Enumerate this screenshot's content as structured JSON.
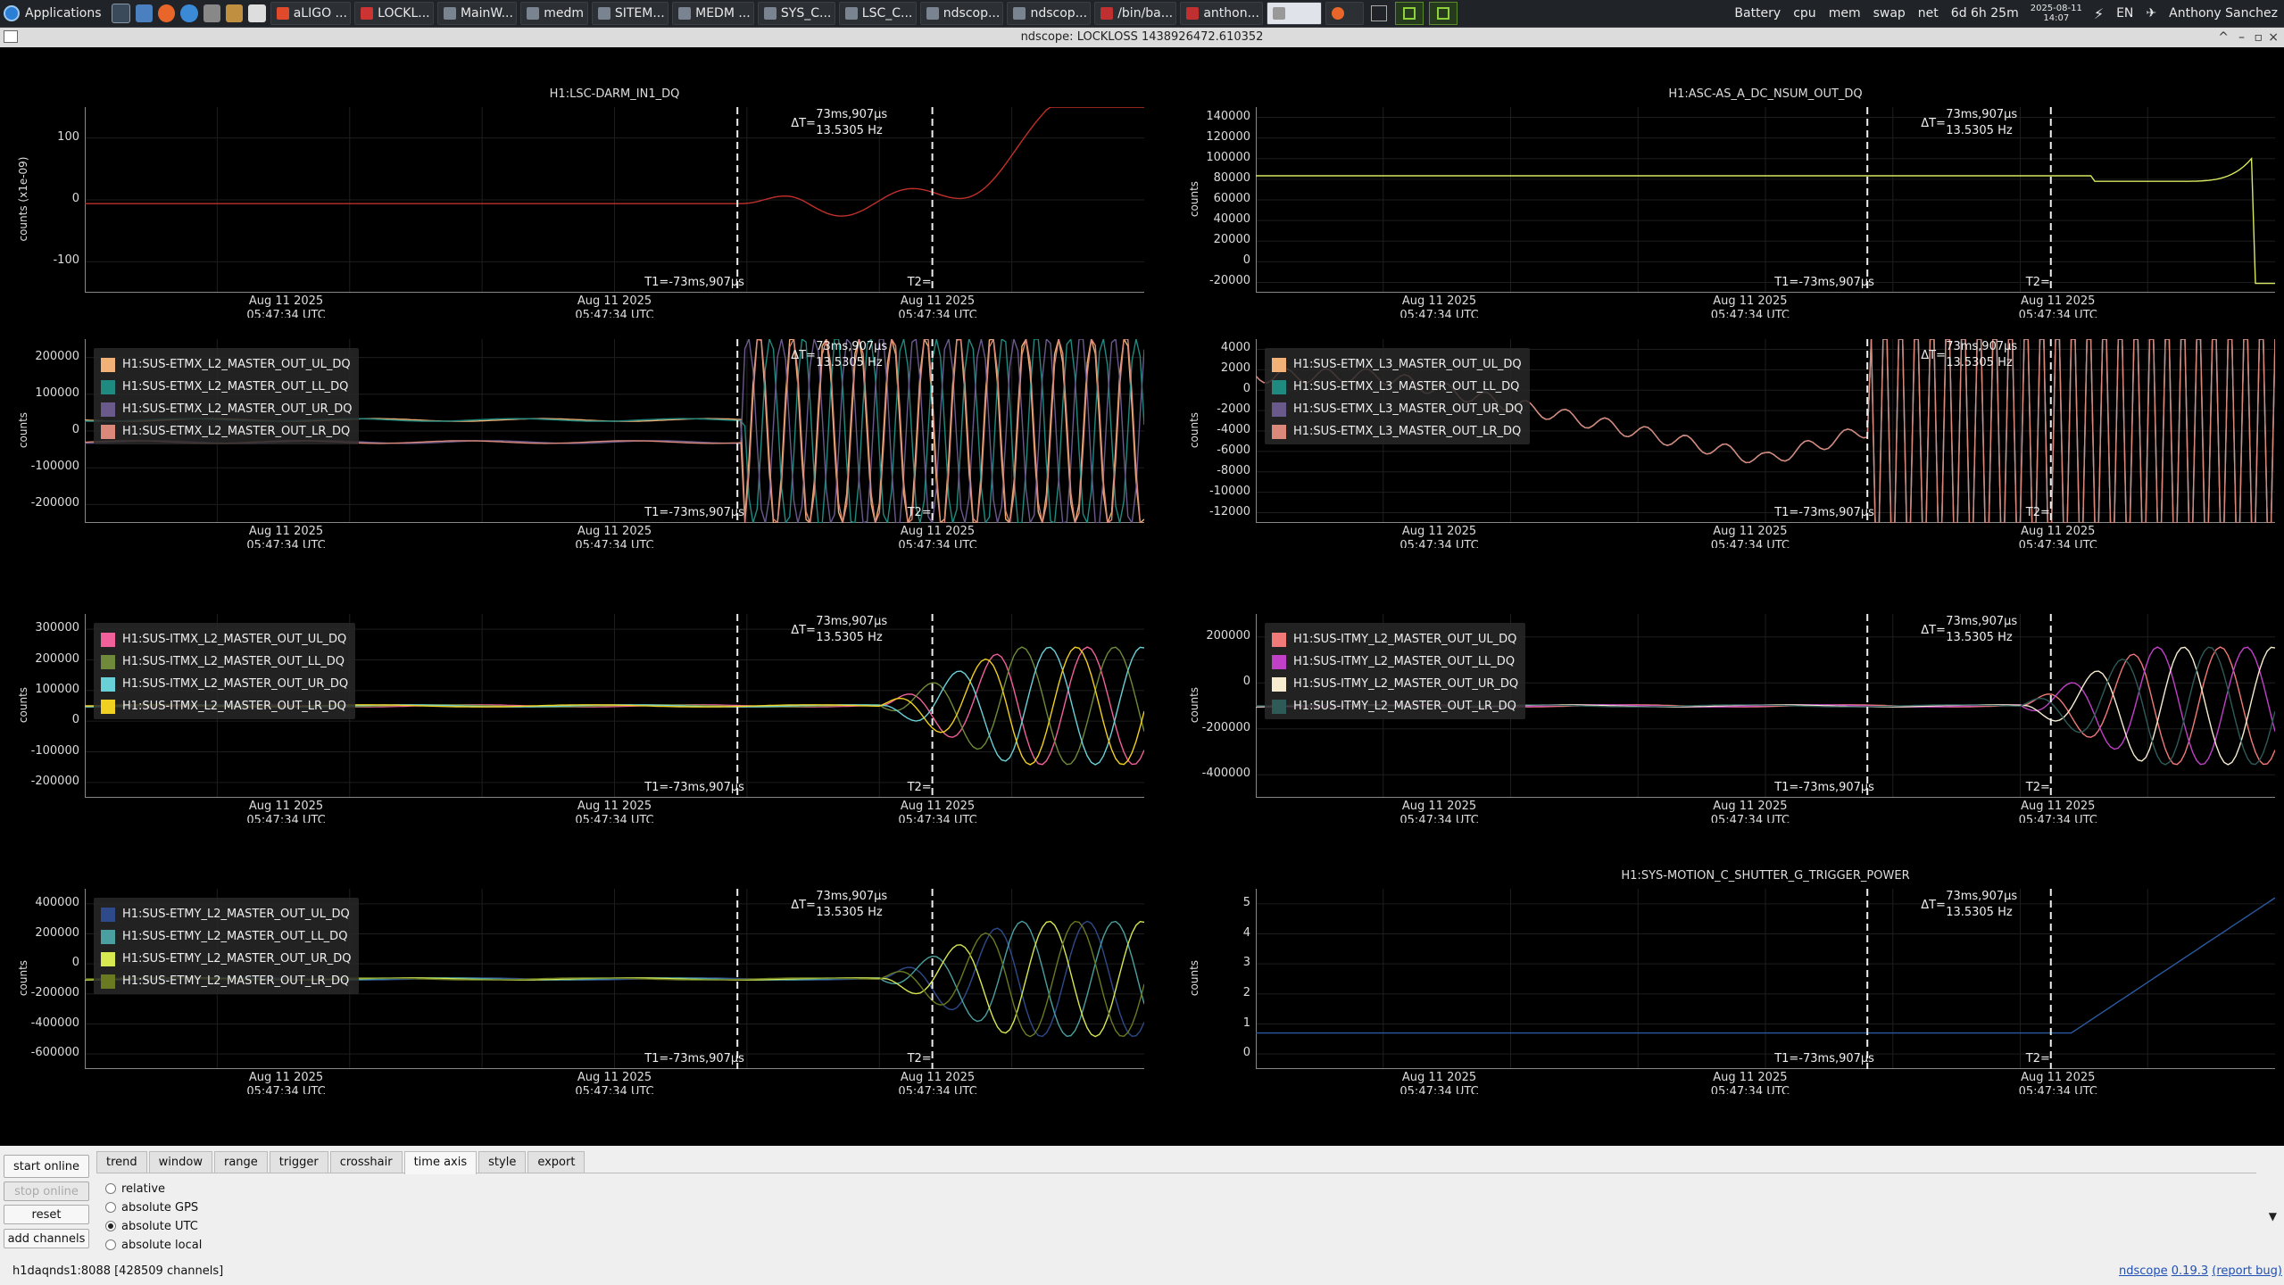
{
  "taskbar": {
    "applications_label": "Applications",
    "tasks": [
      "aLIGO ...",
      "LOCKL...",
      "MainW...",
      "medm",
      "SITEM...",
      "MEDM ...",
      "SYS_C...",
      "LSC_C...",
      "ndscop...",
      "ndscop...",
      "/bin/ba...",
      "anthon..."
    ],
    "tray": {
      "battery": "Battery",
      "cpu": "cpu",
      "mem": "mem",
      "swap": "swap",
      "net": "net",
      "uptime": "6d 6h 25m",
      "date": "2025-08-11",
      "time": "14:07",
      "lang": "EN",
      "user": "Anthony Sanchez"
    }
  },
  "window": {
    "title": "ndscope: LOCKLOSS 1438926472.610352",
    "controls": [
      "^",
      "–",
      "▫",
      "×"
    ]
  },
  "cursors": {
    "delta_t": "ΔT=",
    "delta_value": "73ms,907μs",
    "delta_freq": "13.5305 Hz",
    "t1_label": "T1=-73ms,907μs",
    "t2_label": "T2="
  },
  "x_ticks": [
    {
      "date": "Aug 11 2025",
      "time": "05:47:34 UTC"
    },
    {
      "date": "Aug 11 2025",
      "time": "05:47:34 UTC"
    },
    {
      "date": "Aug 11 2025",
      "time": "05:47:34 UTC"
    }
  ],
  "plots": [
    {
      "id": "darm",
      "title": "H1:LSC-DARM_IN1_DQ",
      "ylabel": "counts (x1e-09)",
      "yticks": [
        "100",
        "0",
        "-100"
      ],
      "legend": []
    },
    {
      "id": "asc",
      "title": "H1:ASC-AS_A_DC_NSUM_OUT_DQ",
      "ylabel": "counts",
      "yticks": [
        "140000",
        "120000",
        "100000",
        "80000",
        "60000",
        "40000",
        "20000",
        "0",
        "-20000"
      ],
      "legend": []
    },
    {
      "id": "etmx-l2",
      "title": "",
      "ylabel": "counts",
      "yticks": [
        "200000",
        "100000",
        "0",
        "-100000",
        "-200000"
      ],
      "legend": [
        {
          "name": "H1:SUS-ETMX_L2_MASTER_OUT_UL_DQ",
          "color": "#f2b176"
        },
        {
          "name": "H1:SUS-ETMX_L2_MASTER_OUT_LL_DQ",
          "color": "#1f8a80"
        },
        {
          "name": "H1:SUS-ETMX_L2_MASTER_OUT_UR_DQ",
          "color": "#6a5a8c"
        },
        {
          "name": "H1:SUS-ETMX_L2_MASTER_OUT_LR_DQ",
          "color": "#d9887a"
        }
      ]
    },
    {
      "id": "etmx-l3",
      "title": "",
      "ylabel": "counts",
      "yticks": [
        "4000",
        "2000",
        "0",
        "-2000",
        "-4000",
        "-6000",
        "-8000",
        "-10000",
        "-12000"
      ],
      "legend": [
        {
          "name": "H1:SUS-ETMX_L3_MASTER_OUT_UL_DQ",
          "color": "#f2b176"
        },
        {
          "name": "H1:SUS-ETMX_L3_MASTER_OUT_LL_DQ",
          "color": "#1f8a80"
        },
        {
          "name": "H1:SUS-ETMX_L3_MASTER_OUT_UR_DQ",
          "color": "#6a5a8c"
        },
        {
          "name": "H1:SUS-ETMX_L3_MASTER_OUT_LR_DQ",
          "color": "#d9887a"
        }
      ]
    },
    {
      "id": "itmx-l2",
      "title": "",
      "ylabel": "counts",
      "yticks": [
        "300000",
        "200000",
        "100000",
        "0",
        "-100000",
        "-200000"
      ],
      "legend": [
        {
          "name": "H1:SUS-ITMX_L2_MASTER_OUT_UL_DQ",
          "color": "#f0609a"
        },
        {
          "name": "H1:SUS-ITMX_L2_MASTER_OUT_LL_DQ",
          "color": "#6f8a3a"
        },
        {
          "name": "H1:SUS-ITMX_L2_MASTER_OUT_UR_DQ",
          "color": "#6ad0d8"
        },
        {
          "name": "H1:SUS-ITMX_L2_MASTER_OUT_LR_DQ",
          "color": "#f0d020"
        }
      ]
    },
    {
      "id": "itmy-l2",
      "title": "",
      "ylabel": "counts",
      "yticks": [
        "200000",
        "0",
        "-200000",
        "-400000"
      ],
      "legend": [
        {
          "name": "H1:SUS-ITMY_L2_MASTER_OUT_UL_DQ",
          "color": "#f07a78"
        },
        {
          "name": "H1:SUS-ITMY_L2_MASTER_OUT_LL_DQ",
          "color": "#c040c8"
        },
        {
          "name": "H1:SUS-ITMY_L2_MASTER_OUT_UR_DQ",
          "color": "#f8ecd0"
        },
        {
          "name": "H1:SUS-ITMY_L2_MASTER_OUT_LR_DQ",
          "color": "#2e5a58"
        }
      ]
    },
    {
      "id": "etmy-l2",
      "title": "",
      "ylabel": "counts",
      "yticks": [
        "400000",
        "200000",
        "0",
        "-200000",
        "-400000",
        "-600000"
      ],
      "legend": [
        {
          "name": "H1:SUS-ETMY_L2_MASTER_OUT_UL_DQ",
          "color": "#2e4a8a"
        },
        {
          "name": "H1:SUS-ETMY_L2_MASTER_OUT_LL_DQ",
          "color": "#4aa0a0"
        },
        {
          "name": "H1:SUS-ETMY_L2_MASTER_OUT_UR_DQ",
          "color": "#d8e850"
        },
        {
          "name": "H1:SUS-ETMY_L2_MASTER_OUT_LR_DQ",
          "color": "#6a7a20"
        }
      ]
    },
    {
      "id": "shutter",
      "title": "H1:SYS-MOTION_C_SHUTTER_G_TRIGGER_POWER",
      "ylabel": "counts",
      "yticks": [
        "5",
        "4",
        "3",
        "2",
        "1",
        "0"
      ],
      "legend": []
    }
  ],
  "controls": {
    "start_online": "start online",
    "stop_online": "stop online",
    "reset": "reset",
    "add_channels": "add channels",
    "tabs": [
      "trend",
      "window",
      "range",
      "trigger",
      "crosshair",
      "time axis",
      "style",
      "export"
    ],
    "selected_tab": "time axis",
    "radios": [
      {
        "label": "relative",
        "checked": false
      },
      {
        "label": "absolute GPS",
        "checked": false
      },
      {
        "label": "absolute UTC",
        "checked": true
      },
      {
        "label": "absolute local",
        "checked": false
      }
    ],
    "status": "h1daqnds1:8088  [428509 channels]",
    "version_name": "ndscope",
    "version_num": "0.19.3",
    "report_bug": "(report bug)"
  }
}
